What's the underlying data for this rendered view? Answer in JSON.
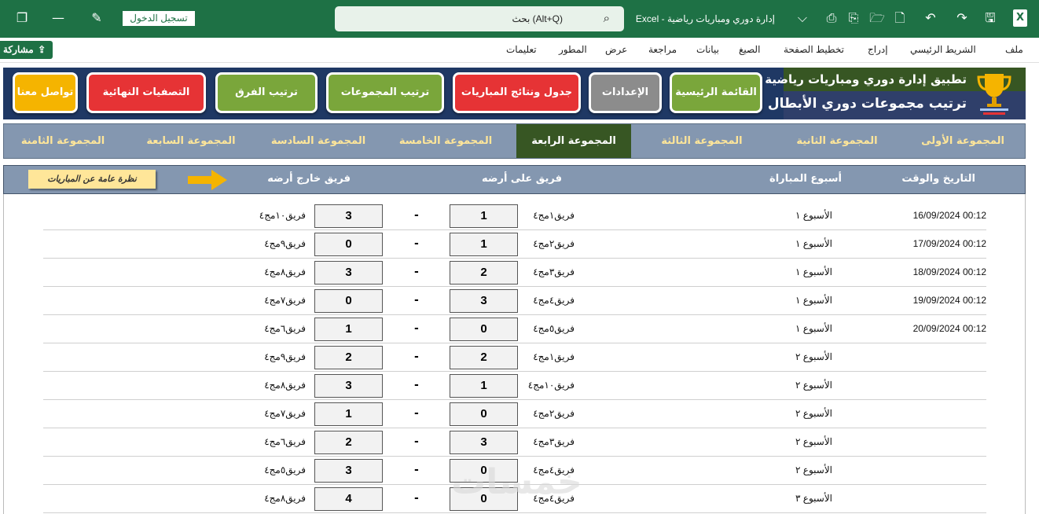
{
  "titlebar": {
    "login_label": "تسجيل الدخول",
    "search_placeholder": "بحث (Alt+Q)",
    "file_name": "إدارة دوري ومباريات رياضية",
    "app_name": "Excel",
    "separator": "-"
  },
  "ribbon": {
    "tabs": [
      "ملف",
      "الشريط الرئيسي",
      "إدراج",
      "تخطيط الصفحة",
      "الصيغ",
      "بيانات",
      "مراجعة",
      "عرض",
      "المطور",
      "تعليمات"
    ],
    "share_label": "مشاركة"
  },
  "header": {
    "brand_line1": "تطبيق إدارة دوري ومباريات رياضية",
    "brand_line2": "ترتيب مجموعات دوري الأبطال",
    "nav": {
      "main_menu": "القائمة الرئيسية",
      "settings": "الإعدادات",
      "schedule": "جدول ونتائج المباريات",
      "group_standings": "ترتيب المجموعات",
      "team_standings": "ترتيب الفرق",
      "finals": "التصفيات النهائية",
      "contact": "تواصل معنا"
    }
  },
  "groups": [
    "المجموعة الأولى",
    "المجموعة الثانية",
    "المجموعة الثالثة",
    "المجموعة الرابعة",
    "المجموعة الخامسة",
    "المجموعة السادسة",
    "المجموعة السابعة",
    "المجموعة الثامنة"
  ],
  "active_group": "المجموعة الرابعة",
  "columns": {
    "datetime": "التاريخ والوقت",
    "week": "أسبوع المباراة",
    "home": "فريق على أرضه",
    "away": "فريق خارج أرضه",
    "overview": "نظرة عامة عن المباريات"
  },
  "matches": [
    {
      "datetime": "16/09/2024 00:12",
      "week": "الأسبوع ١",
      "home": "فريق١مج٤",
      "home_score": "1",
      "sep": "-",
      "away_score": "3",
      "away": "فريق١٠مج٤"
    },
    {
      "datetime": "17/09/2024 00:12",
      "week": "الأسبوع ١",
      "home": "فريق٢مج٤",
      "home_score": "1",
      "sep": "-",
      "away_score": "0",
      "away": "فريق٩مج٤"
    },
    {
      "datetime": "18/09/2024 00:12",
      "week": "الأسبوع ١",
      "home": "فريق٣مج٤",
      "home_score": "2",
      "sep": "-",
      "away_score": "3",
      "away": "فريق٨مج٤"
    },
    {
      "datetime": "19/09/2024 00:12",
      "week": "الأسبوع ١",
      "home": "فريق٤مج٤",
      "home_score": "3",
      "sep": "-",
      "away_score": "0",
      "away": "فريق٧مج٤"
    },
    {
      "datetime": "20/09/2024 00:12",
      "week": "الأسبوع ١",
      "home": "فريق٥مج٤",
      "home_score": "0",
      "sep": "-",
      "away_score": "1",
      "away": "فريق٦مج٤"
    },
    {
      "datetime": "",
      "week": "الأسبوع ٢",
      "home": "فريق١مج٤",
      "home_score": "2",
      "sep": "-",
      "away_score": "2",
      "away": "فريق٩مج٤"
    },
    {
      "datetime": "",
      "week": "الأسبوع ٢",
      "home": "فريق١٠مج٤",
      "home_score": "1",
      "sep": "-",
      "away_score": "3",
      "away": "فريق٨مج٤"
    },
    {
      "datetime": "",
      "week": "الأسبوع ٢",
      "home": "فريق٢مج٤",
      "home_score": "0",
      "sep": "-",
      "away_score": "1",
      "away": "فريق٧مج٤"
    },
    {
      "datetime": "",
      "week": "الأسبوع ٢",
      "home": "فريق٣مج٤",
      "home_score": "3",
      "sep": "-",
      "away_score": "2",
      "away": "فريق٦مج٤"
    },
    {
      "datetime": "",
      "week": "الأسبوع ٢",
      "home": "فريق٤مج٤",
      "home_score": "0",
      "sep": "-",
      "away_score": "3",
      "away": "فريق٥مج٤"
    },
    {
      "datetime": "",
      "week": "الأسبوع ٣",
      "home": "فريق٤مج٤",
      "home_score": "0",
      "sep": "-",
      "away_score": "4",
      "away": "فريق٨مج٤"
    }
  ],
  "watermark": "خمسات",
  "colors": {
    "excel_green": "#1e7145",
    "header_blue": "#8497b0",
    "active_group": "#375623"
  }
}
